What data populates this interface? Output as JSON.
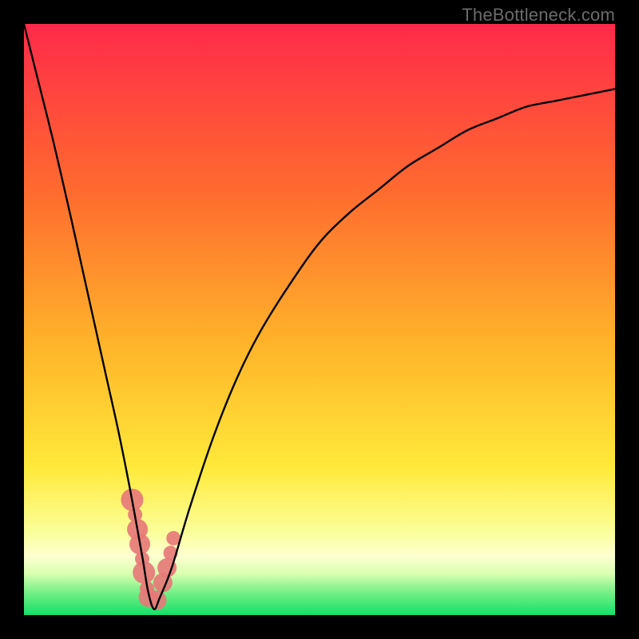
{
  "watermark": {
    "text": "TheBottleneck.com"
  },
  "colors": {
    "red_top": "#ff2a4a",
    "orange": "#ff8a2a",
    "yellow": "#ffeb3a",
    "pale_yellow": "#fbffa8",
    "green": "#17e36a",
    "curve_stroke": "#000000",
    "marker_fill": "#e67a78",
    "marker_stroke": "#8a4a4a",
    "frame": "#000000"
  },
  "chart_data": {
    "type": "line",
    "title": "",
    "xlabel": "",
    "ylabel": "",
    "xlim": [
      0,
      100
    ],
    "ylim": [
      0,
      100
    ],
    "series": [
      {
        "name": "bottleneck-curve",
        "x": [
          0,
          2,
          5,
          8,
          10,
          12,
          14,
          16,
          18,
          20,
          21,
          22,
          23,
          25,
          28,
          32,
          36,
          40,
          45,
          50,
          55,
          60,
          65,
          70,
          75,
          80,
          85,
          90,
          95,
          100
        ],
        "y": [
          100,
          92,
          80,
          67,
          58,
          49,
          40,
          31,
          21,
          10,
          4,
          1,
          3,
          8,
          18,
          30,
          40,
          48,
          56,
          63,
          68,
          72,
          76,
          79,
          82,
          84,
          86,
          87,
          88,
          89
        ]
      }
    ],
    "markers": {
      "name": "benchmark-points",
      "x": [
        18.3,
        18.8,
        19.2,
        19.6,
        20.0,
        20.3,
        20.8,
        21.0,
        22.5,
        23.5,
        24.2,
        24.8,
        25.3
      ],
      "y": [
        19.5,
        17.0,
        14.5,
        12.0,
        9.5,
        7.2,
        4.5,
        3.0,
        2.5,
        5.5,
        8.0,
        10.5,
        13.0
      ],
      "r": [
        14,
        9,
        13,
        13,
        9,
        14,
        9,
        12,
        12,
        12,
        12,
        9,
        9
      ]
    }
  }
}
